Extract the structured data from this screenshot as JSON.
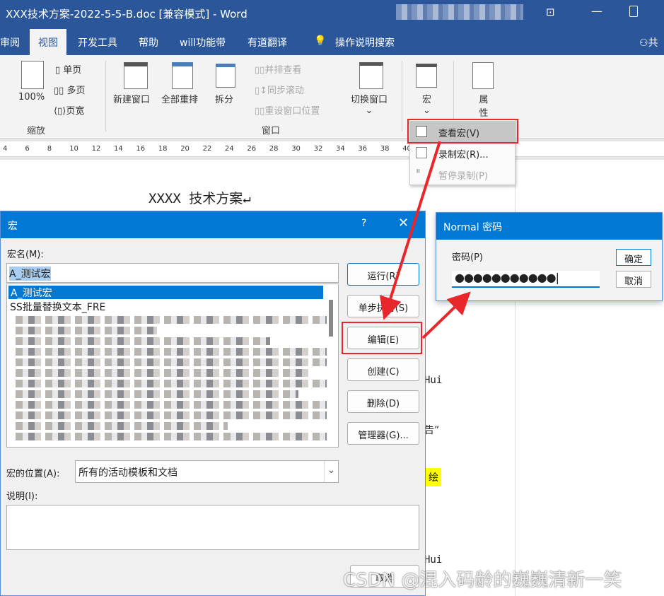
{
  "window": {
    "title": "XXX技术方案-2022-5-5-B.doc [兼容模式] - Word"
  },
  "tabs": [
    {
      "label": "审阅"
    },
    {
      "label": "视图"
    },
    {
      "label": "开发工具"
    },
    {
      "label": "帮助"
    },
    {
      "label": "will功能带"
    },
    {
      "label": "有道翻译"
    },
    {
      "label": "操作说明搜索"
    },
    {
      "label": "共"
    }
  ],
  "ribbon": {
    "zoom_group": {
      "label": "缩放",
      "zoom100": "100%",
      "single": "单页",
      "multi": "多页",
      "width": "页宽"
    },
    "window_group": {
      "label": "窗口",
      "new_window": "新建窗口",
      "arrange_all": "全部重排",
      "split": "拆分",
      "side_by_side": "并排查看",
      "sync_scroll": "同步滚动",
      "reset_pos": "重设窗口位置",
      "switch": "切换窗口"
    },
    "macro": "宏",
    "properties": "属性"
  },
  "ruler": [
    "4",
    "6",
    "8",
    "10",
    "12",
    "14",
    "16",
    "18",
    "20",
    "22",
    "24",
    "26",
    "28",
    "30",
    "32",
    "34",
    "36",
    "38",
    "40"
  ],
  "macro_menu": {
    "items": [
      {
        "label": "查看宏(V)"
      },
      {
        "label": "录制宏(R)..."
      },
      {
        "label": "暂停录制(P)"
      }
    ]
  },
  "document": {
    "heading": "XXXX 技术方案↵",
    "fragments": [
      "Hui",
      "告”",
      "绘",
      "Hui"
    ]
  },
  "macro_dialog": {
    "title": "宏",
    "help": "?",
    "name_label": "宏名(M):",
    "name_value": "A_测试宏",
    "list": [
      "A_测试宏",
      "SS批量替换文本_FRE"
    ],
    "buttons": {
      "run": "运行(R)",
      "step": "单步执行(S)",
      "edit": "编辑(E)",
      "create": "创建(C)",
      "delete": "删除(D)",
      "organizer": "管理器(G)...",
      "cancel": "取消"
    },
    "location_label": "宏的位置(A):",
    "location_value": "所有的活动模板和文档",
    "desc_label": "说明(I):"
  },
  "password_dialog": {
    "title": "Normal 密码",
    "label": "密码(P)",
    "value": "●●●●●●●●●●●",
    "ok": "确定",
    "cancel": "取消"
  },
  "annotation_color": "#e8262b",
  "watermark": "CSDN @混入码龄的巍巍清新一笑"
}
